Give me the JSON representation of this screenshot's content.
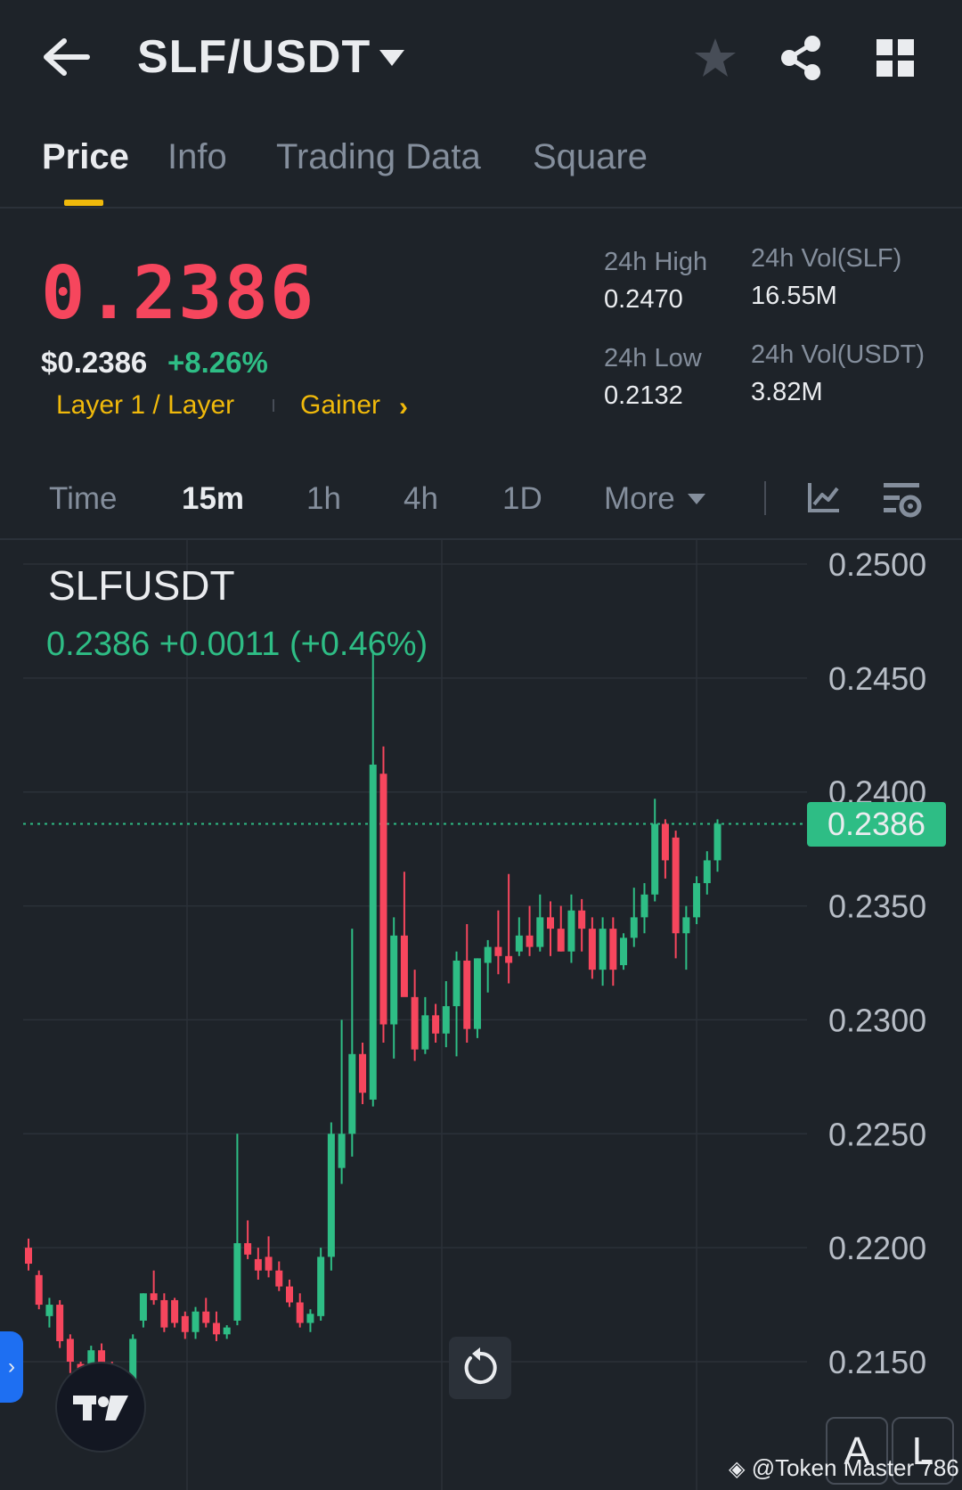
{
  "header": {
    "pair": "SLF/USDT",
    "icons": [
      "back-arrow-icon",
      "caret-down-icon",
      "star-icon",
      "share-icon",
      "grid-icon"
    ]
  },
  "tabs": [
    {
      "label": "Price",
      "active": true
    },
    {
      "label": "Info",
      "active": false
    },
    {
      "label": "Trading Data",
      "active": false
    },
    {
      "label": "Square",
      "active": false
    }
  ],
  "summary": {
    "last_price": "0.2386",
    "usd_price": "$0.2386",
    "change_pct": "+8.26%",
    "tag_sector": "Layer 1 / Layer",
    "tag_gainer": "Gainer",
    "chevron": "›",
    "high_label": "24h High",
    "high_value": "0.2470",
    "low_label": "24h Low",
    "low_value": "0.2132",
    "vol_base_label": "24h Vol(SLF)",
    "vol_base_value": "16.55M",
    "vol_quote_label": "24h Vol(USDT)",
    "vol_quote_value": "3.82M"
  },
  "intervals": {
    "time": "Time",
    "m15": "15m",
    "h1": "1h",
    "h4": "4h",
    "d1": "1D",
    "more": "More",
    "active": "15m"
  },
  "chart": {
    "symbol": "SLFUSDT",
    "ohlc_text": "0.2386  +0.0011 (+0.46%)",
    "price_badge": "0.2386",
    "axis_buttons": {
      "auto": "A",
      "log": "L"
    },
    "watermark": "@Token Master 786",
    "tv_logo": "17",
    "reset_icon": "↻",
    "expand_icon": "›"
  },
  "colors": {
    "up": "#2ebd85",
    "down": "#f6465d",
    "accent": "#f0b90b",
    "background": "#1e2329"
  },
  "chart_data": {
    "type": "candlestick",
    "interval": "15m",
    "yticks": [
      "0.2500",
      "0.2450",
      "0.2400",
      "0.2350",
      "0.2300",
      "0.2250",
      "0.2200",
      "0.2150"
    ],
    "ylim": [
      0.2095,
      0.251
    ],
    "last_price": 0.2386,
    "candles": [
      {
        "o": 0.22,
        "h": 0.2204,
        "l": 0.219,
        "c": 0.2193
      },
      {
        "o": 0.2188,
        "h": 0.219,
        "l": 0.2173,
        "c": 0.2175
      },
      {
        "o": 0.217,
        "h": 0.2178,
        "l": 0.2165,
        "c": 0.2175
      },
      {
        "o": 0.2175,
        "h": 0.2177,
        "l": 0.2156,
        "c": 0.2159
      },
      {
        "o": 0.216,
        "h": 0.2162,
        "l": 0.2145,
        "c": 0.215
      },
      {
        "o": 0.2149,
        "h": 0.215,
        "l": 0.214,
        "c": 0.2143
      },
      {
        "o": 0.2143,
        "h": 0.2157,
        "l": 0.214,
        "c": 0.2155
      },
      {
        "o": 0.2155,
        "h": 0.2158,
        "l": 0.2138,
        "c": 0.214
      },
      {
        "o": 0.214,
        "h": 0.215,
        "l": 0.2128,
        "c": 0.2132
      },
      {
        "o": 0.2132,
        "h": 0.2145,
        "l": 0.213,
        "c": 0.2142
      },
      {
        "o": 0.214,
        "h": 0.2162,
        "l": 0.2138,
        "c": 0.216
      },
      {
        "o": 0.2168,
        "h": 0.218,
        "l": 0.2165,
        "c": 0.218
      },
      {
        "o": 0.218,
        "h": 0.219,
        "l": 0.2175,
        "c": 0.2177
      },
      {
        "o": 0.2177,
        "h": 0.218,
        "l": 0.2163,
        "c": 0.2165
      },
      {
        "o": 0.2177,
        "h": 0.2178,
        "l": 0.2165,
        "c": 0.2167
      },
      {
        "o": 0.217,
        "h": 0.2172,
        "l": 0.216,
        "c": 0.2163
      },
      {
        "o": 0.2163,
        "h": 0.2174,
        "l": 0.216,
        "c": 0.2172
      },
      {
        "o": 0.2172,
        "h": 0.2178,
        "l": 0.2165,
        "c": 0.2167
      },
      {
        "o": 0.2167,
        "h": 0.2172,
        "l": 0.2159,
        "c": 0.2162
      },
      {
        "o": 0.2162,
        "h": 0.2166,
        "l": 0.216,
        "c": 0.2165
      },
      {
        "o": 0.2168,
        "h": 0.225,
        "l": 0.2166,
        "c": 0.2202
      },
      {
        "o": 0.2202,
        "h": 0.2212,
        "l": 0.2195,
        "c": 0.2197
      },
      {
        "o": 0.2195,
        "h": 0.22,
        "l": 0.2186,
        "c": 0.219
      },
      {
        "o": 0.2196,
        "h": 0.2205,
        "l": 0.2187,
        "c": 0.219
      },
      {
        "o": 0.219,
        "h": 0.2194,
        "l": 0.2181,
        "c": 0.2183
      },
      {
        "o": 0.2183,
        "h": 0.2186,
        "l": 0.2174,
        "c": 0.2176
      },
      {
        "o": 0.2176,
        "h": 0.218,
        "l": 0.2165,
        "c": 0.2167
      },
      {
        "o": 0.2167,
        "h": 0.2173,
        "l": 0.2163,
        "c": 0.2171
      },
      {
        "o": 0.217,
        "h": 0.22,
        "l": 0.2168,
        "c": 0.2196
      },
      {
        "o": 0.2196,
        "h": 0.2255,
        "l": 0.219,
        "c": 0.225
      },
      {
        "o": 0.2235,
        "h": 0.23,
        "l": 0.2228,
        "c": 0.225
      },
      {
        "o": 0.225,
        "h": 0.234,
        "l": 0.224,
        "c": 0.2285
      },
      {
        "o": 0.2285,
        "h": 0.229,
        "l": 0.2263,
        "c": 0.2268
      },
      {
        "o": 0.2265,
        "h": 0.2462,
        "l": 0.2262,
        "c": 0.2412
      },
      {
        "o": 0.2408,
        "h": 0.242,
        "l": 0.229,
        "c": 0.2298
      },
      {
        "o": 0.2298,
        "h": 0.2345,
        "l": 0.2283,
        "c": 0.2337
      },
      {
        "o": 0.2337,
        "h": 0.2365,
        "l": 0.2322,
        "c": 0.231
      },
      {
        "o": 0.231,
        "h": 0.2322,
        "l": 0.2282,
        "c": 0.2287
      },
      {
        "o": 0.2287,
        "h": 0.231,
        "l": 0.2285,
        "c": 0.2302
      },
      {
        "o": 0.2302,
        "h": 0.2307,
        "l": 0.229,
        "c": 0.2294
      },
      {
        "o": 0.2294,
        "h": 0.2317,
        "l": 0.2288,
        "c": 0.2306
      },
      {
        "o": 0.2306,
        "h": 0.233,
        "l": 0.2284,
        "c": 0.2326
      },
      {
        "o": 0.2326,
        "h": 0.2342,
        "l": 0.229,
        "c": 0.2296
      },
      {
        "o": 0.2296,
        "h": 0.2327,
        "l": 0.2292,
        "c": 0.2327
      },
      {
        "o": 0.2325,
        "h": 0.2335,
        "l": 0.2312,
        "c": 0.2332
      },
      {
        "o": 0.2332,
        "h": 0.2348,
        "l": 0.232,
        "c": 0.2328
      },
      {
        "o": 0.2328,
        "h": 0.2364,
        "l": 0.2316,
        "c": 0.2325
      },
      {
        "o": 0.233,
        "h": 0.2345,
        "l": 0.2328,
        "c": 0.2337
      },
      {
        "o": 0.2337,
        "h": 0.235,
        "l": 0.2328,
        "c": 0.2332
      },
      {
        "o": 0.2332,
        "h": 0.2355,
        "l": 0.233,
        "c": 0.2345
      },
      {
        "o": 0.2345,
        "h": 0.2352,
        "l": 0.2328,
        "c": 0.234
      },
      {
        "o": 0.234,
        "h": 0.235,
        "l": 0.233,
        "c": 0.233
      },
      {
        "o": 0.233,
        "h": 0.2355,
        "l": 0.2325,
        "c": 0.2348
      },
      {
        "o": 0.2348,
        "h": 0.2353,
        "l": 0.233,
        "c": 0.234
      },
      {
        "o": 0.234,
        "h": 0.2345,
        "l": 0.2318,
        "c": 0.2322
      },
      {
        "o": 0.2322,
        "h": 0.2345,
        "l": 0.2315,
        "c": 0.234
      },
      {
        "o": 0.234,
        "h": 0.2345,
        "l": 0.2315,
        "c": 0.2322
      },
      {
        "o": 0.2324,
        "h": 0.2338,
        "l": 0.2322,
        "c": 0.2336
      },
      {
        "o": 0.2336,
        "h": 0.2358,
        "l": 0.2332,
        "c": 0.2345
      },
      {
        "o": 0.2345,
        "h": 0.236,
        "l": 0.2338,
        "c": 0.2355
      },
      {
        "o": 0.2355,
        "h": 0.2397,
        "l": 0.2352,
        "c": 0.2386
      },
      {
        "o": 0.2386,
        "h": 0.2388,
        "l": 0.2362,
        "c": 0.237
      },
      {
        "o": 0.238,
        "h": 0.2383,
        "l": 0.2327,
        "c": 0.2338
      },
      {
        "o": 0.2338,
        "h": 0.235,
        "l": 0.2322,
        "c": 0.2345
      },
      {
        "o": 0.2345,
        "h": 0.2363,
        "l": 0.2342,
        "c": 0.236
      },
      {
        "o": 0.236,
        "h": 0.2374,
        "l": 0.2355,
        "c": 0.237
      },
      {
        "o": 0.237,
        "h": 0.2388,
        "l": 0.2365,
        "c": 0.2386
      }
    ]
  }
}
